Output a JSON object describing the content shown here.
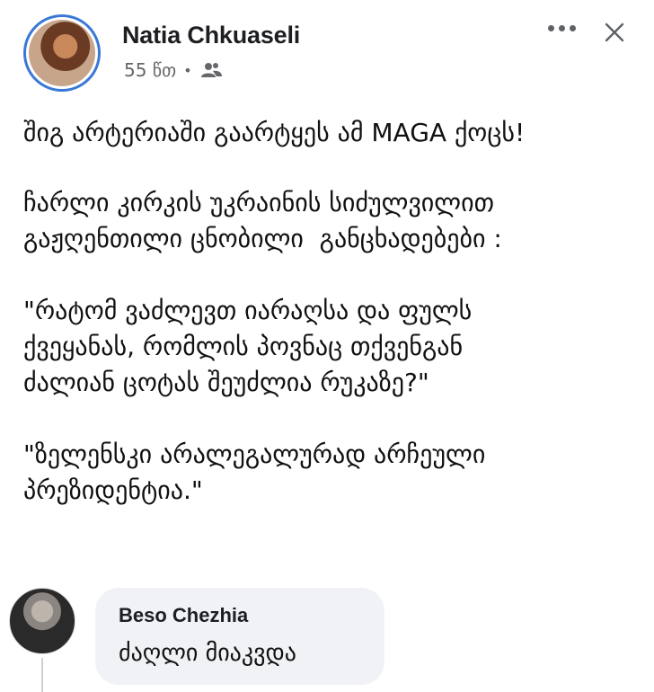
{
  "post": {
    "author": "Natia Chkuaseli",
    "time": "55 წთ",
    "separator": "•",
    "audience_icon": "friends-icon",
    "paragraphs": [
      "შიგ არტერიაში გაარტყეს ამ MAGA ქოცს!",
      "ჩარლი კირკის უკრაინის სიძულვილით\nგაჟღენთილი ცნობილი  განცხადებები :",
      "\"რატომ ვაძლევთ იარაღსა და ფულს\nქვეყანას, რომლის პოვნაც თქვენგან\nძალიან ცოტას შეუძლია რუკაზე?\"",
      "\"ზელენსკი არალეგალურად არჩეული\nპრეზიდენტია.\""
    ]
  },
  "comment": {
    "author": "Beso Chezhia",
    "text": "ძაღლი მიაკვდა"
  },
  "colors": {
    "avatar_ring": "#3a78d6",
    "secondary_text": "#65676b",
    "comment_bg": "#f0f2f5"
  }
}
